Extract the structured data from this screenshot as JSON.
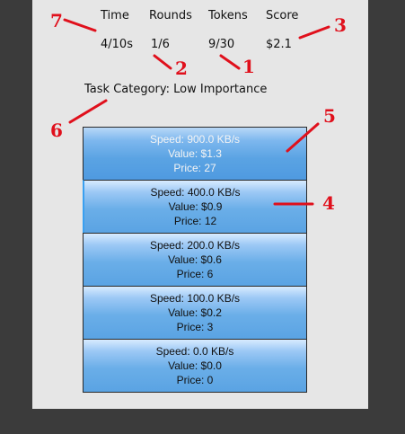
{
  "stats": {
    "time": {
      "label": "Time",
      "value": "4/10s"
    },
    "rounds": {
      "label": "Rounds",
      "value": "1/6"
    },
    "tokens": {
      "label": "Tokens",
      "value": "9/30"
    },
    "score": {
      "label": "Score",
      "value": "$2.1"
    }
  },
  "category": "Task Category: Low Importance",
  "options": [
    {
      "speed": "Speed: 900.0 KB/s",
      "value": "Value: $1.3",
      "price": "Price: 27"
    },
    {
      "speed": "Speed: 400.0 KB/s",
      "value": "Value: $0.9",
      "price": "Price: 12"
    },
    {
      "speed": "Speed: 200.0 KB/s",
      "value": "Value: $0.6",
      "price": "Price: 6"
    },
    {
      "speed": "Speed: 100.0 KB/s",
      "value": "Value: $0.2",
      "price": "Price: 3"
    },
    {
      "speed": "Speed: 0.0 KB/s",
      "value": "Value: $0.0",
      "price": "Price: 0"
    }
  ],
  "annotations": [
    "1",
    "2",
    "3",
    "4",
    "5",
    "6",
    "7"
  ],
  "colors": {
    "annotation": "#e0101c",
    "panel": "#e6e6e6",
    "option": "#6aaee8"
  }
}
